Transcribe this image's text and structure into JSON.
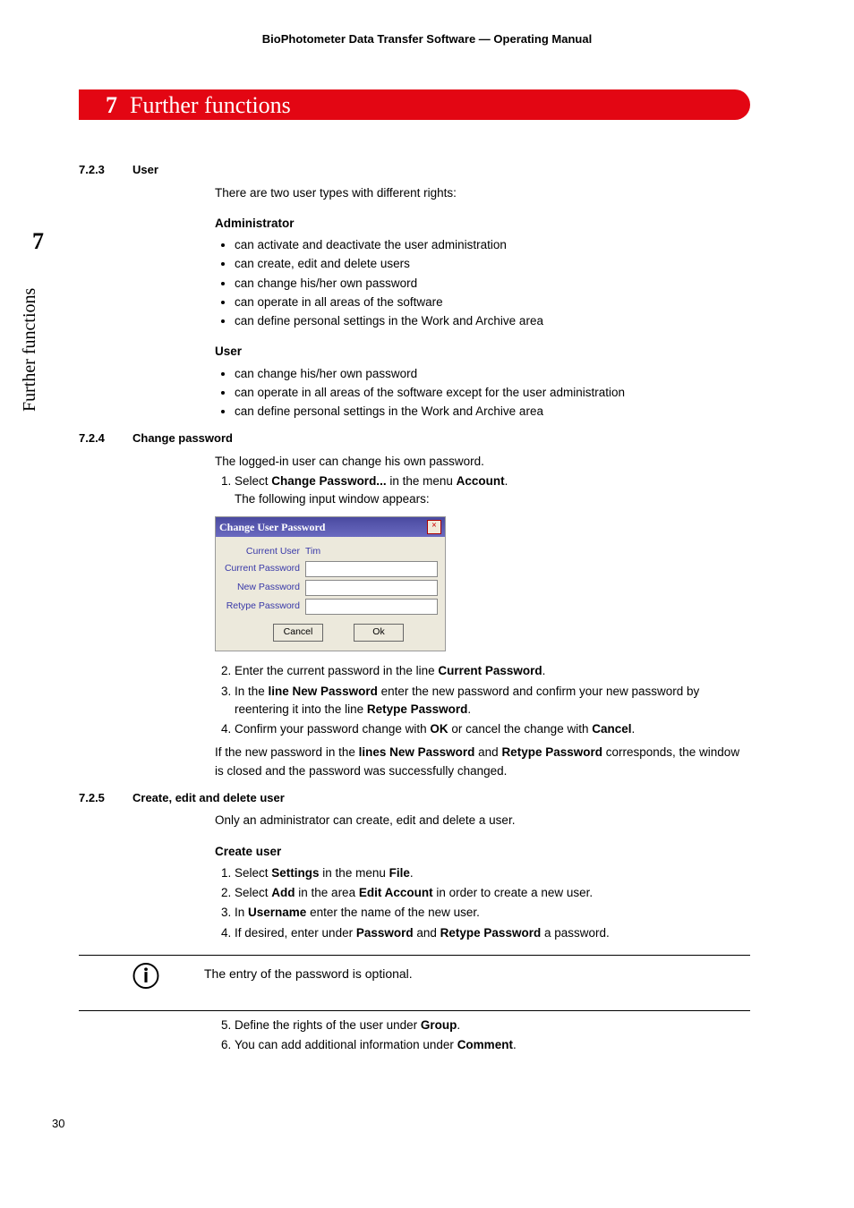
{
  "header": "BioPhotometer Data Transfer Software  —  Operating Manual",
  "chapter": {
    "num": "7",
    "title": "Further functions"
  },
  "side": {
    "num": "7",
    "label": "Further functions"
  },
  "pageNumber": "30",
  "sec723": {
    "num": "7.2.3",
    "title": "User",
    "intro": "There are two user types with different rights:",
    "adminHead": "Administrator",
    "adminItems": [
      "can activate and deactivate the user administration",
      "can create, edit and delete users",
      "can change his/her own password",
      "can operate in all areas of the software",
      "can define personal settings in the Work and Archive area"
    ],
    "userHead": "User",
    "userItems": [
      "can change his/her own password",
      "can operate in all areas of the software except for the user administration",
      "can define personal settings in the Work and Archive area"
    ]
  },
  "sec724": {
    "num": "7.2.4",
    "title": "Change password",
    "line1": "The logged-in user can change his own password.",
    "step1_a": "Select ",
    "step1_b": "Change Password...",
    "step1_c": " in the menu ",
    "step1_d": "Account",
    "step1_e": ".",
    "step1_line2": "The following input window appears:",
    "dialog": {
      "title": "Change User Password",
      "currentUserLabel": "Current User",
      "currentUserValue": "Tim",
      "currentPasswordLabel": "Current Password",
      "newPasswordLabel": "New Password",
      "retypePasswordLabel": "Retype Password",
      "cancel": "Cancel",
      "ok": "Ok"
    },
    "step2_a": "Enter the current password in the line ",
    "step2_b": "Current Password",
    "step2_c": ".",
    "step3_a": "In the ",
    "step3_b": "line New Password",
    "step3_c": " enter the new password and confirm your new password by reentering it into the line ",
    "step3_d": "Retype Password",
    "step3_e": ".",
    "step4_a": "Confirm your password change with ",
    "step4_b": "OK",
    "step4_c": " or cancel the change with ",
    "step4_d": "Cancel",
    "step4_e": ".",
    "tail_a": "If the new password in the ",
    "tail_b": "lines New Password",
    "tail_c": " and ",
    "tail_d": "Retype Password",
    "tail_e": " corresponds, the window is closed and the password was successfully changed."
  },
  "sec725": {
    "num": "7.2.5",
    "title": "Create, edit and delete user",
    "line1": "Only an administrator can create, edit and delete a user.",
    "createHead": "Create user",
    "s1_a": "Select ",
    "s1_b": "Settings",
    "s1_c": " in the menu ",
    "s1_d": "File",
    "s1_e": ".",
    "s2_a": "Select ",
    "s2_b": "Add",
    "s2_c": " in the area ",
    "s2_d": "Edit Account",
    "s2_e": " in order to create a new user.",
    "s3_a": "In ",
    "s3_b": "Username",
    "s3_c": " enter the name of the new user.",
    "s4_a": "If desired, enter under ",
    "s4_b": "Password",
    "s4_c": " and ",
    "s4_d": "Retype Password",
    "s4_e": " a password.",
    "note": "The entry of the password is optional.",
    "s5_a": "Define the rights of the user under ",
    "s5_b": "Group",
    "s5_c": ".",
    "s6_a": "You can add additional information under ",
    "s6_b": "Comment",
    "s6_c": "."
  }
}
